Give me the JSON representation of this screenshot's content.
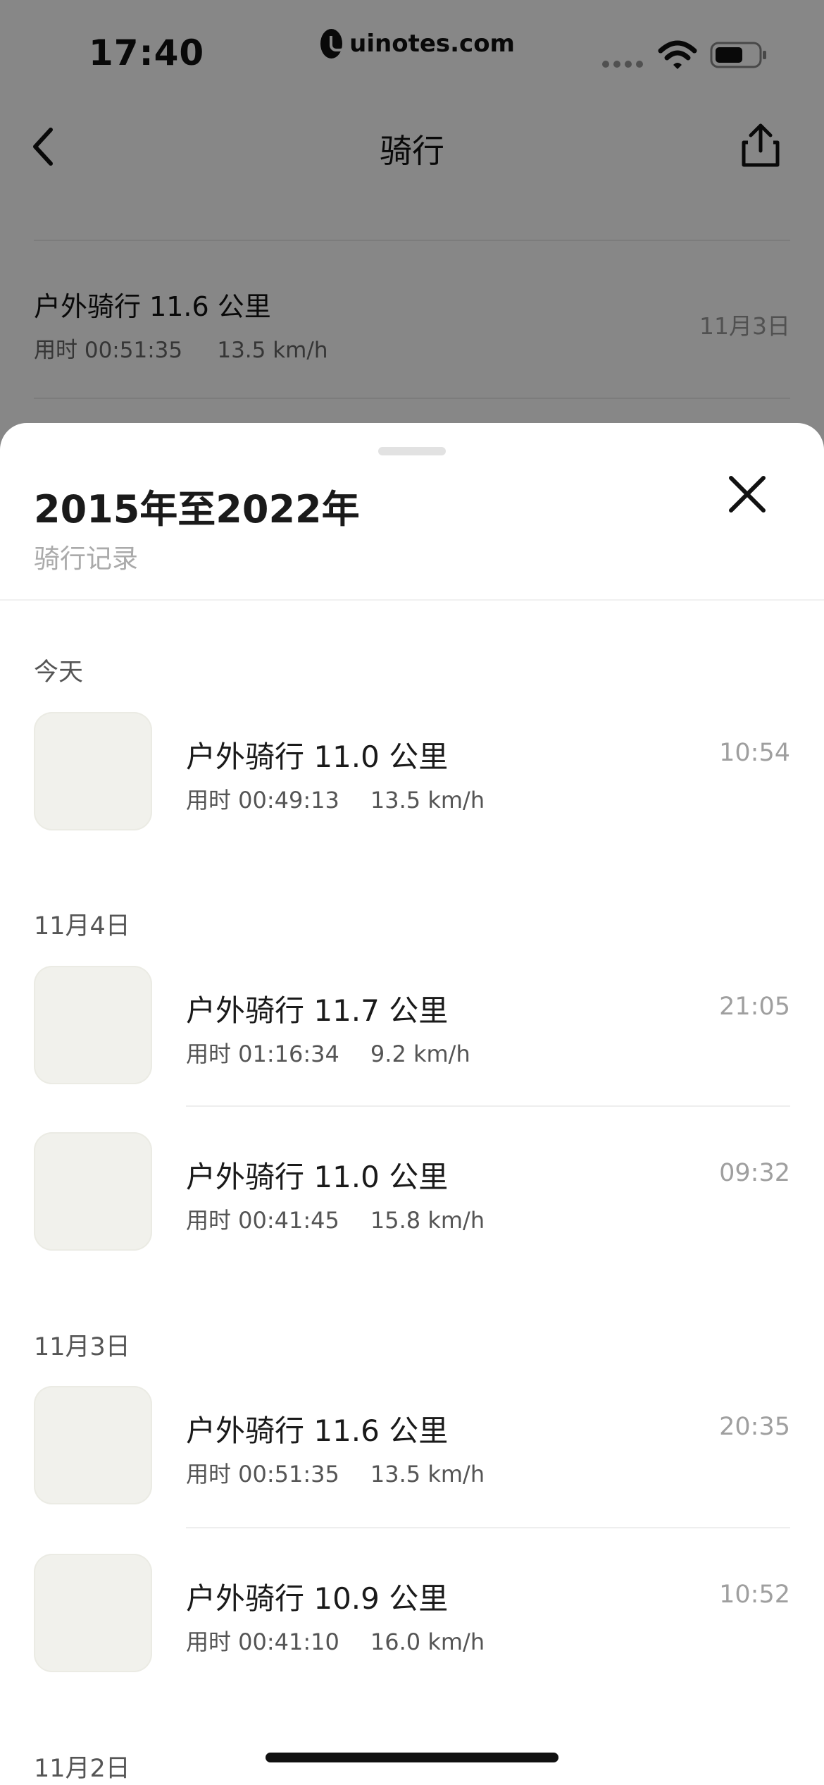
{
  "status_bar": {
    "time": "17:40",
    "watermark": "uinotes.com",
    "icons": [
      "signal-dots-icon",
      "wifi-icon",
      "battery-icon"
    ]
  },
  "nav": {
    "title": "骑行",
    "back_icon": "chevron-left-icon",
    "share_icon": "share-icon"
  },
  "background_list": [
    {
      "title": "户外骑行 11.6 公里",
      "subtitle": "用时 00:51:35     13.5 km/h",
      "date": "11月3日"
    }
  ],
  "sheet": {
    "title": "2015年至2022年",
    "subtitle": "骑行记录",
    "close_icon": "close-icon",
    "sections": [
      {
        "label": "今天",
        "records": [
          {
            "title": "户外骑行 11.0 公里",
            "duration": "用时 00:49:13",
            "speed": "13.5 km/h",
            "time": "10:54"
          }
        ]
      },
      {
        "label": "11月4日",
        "records": [
          {
            "title": "户外骑行 11.7 公里",
            "duration": "用时 01:16:34",
            "speed": "9.2 km/h",
            "time": "21:05"
          },
          {
            "title": "户外骑行 11.0 公里",
            "duration": "用时 00:41:45",
            "speed": "15.8 km/h",
            "time": "09:32"
          }
        ]
      },
      {
        "label": "11月3日",
        "records": [
          {
            "title": "户外骑行 11.6 公里",
            "duration": "用时 00:51:35",
            "speed": "13.5 km/h",
            "time": "20:35"
          },
          {
            "title": "户外骑行 10.9 公里",
            "duration": "用时 00:41:10",
            "speed": "16.0 km/h",
            "time": "10:52"
          }
        ]
      },
      {
        "label": "11月2日",
        "records": []
      }
    ]
  },
  "colors": {
    "sheet_background": "#ffffff",
    "overlay": "#7b7b7b",
    "primary_text": "#1a1a1a",
    "secondary_text": "#555555",
    "muted_text": "#9f9f9f"
  }
}
